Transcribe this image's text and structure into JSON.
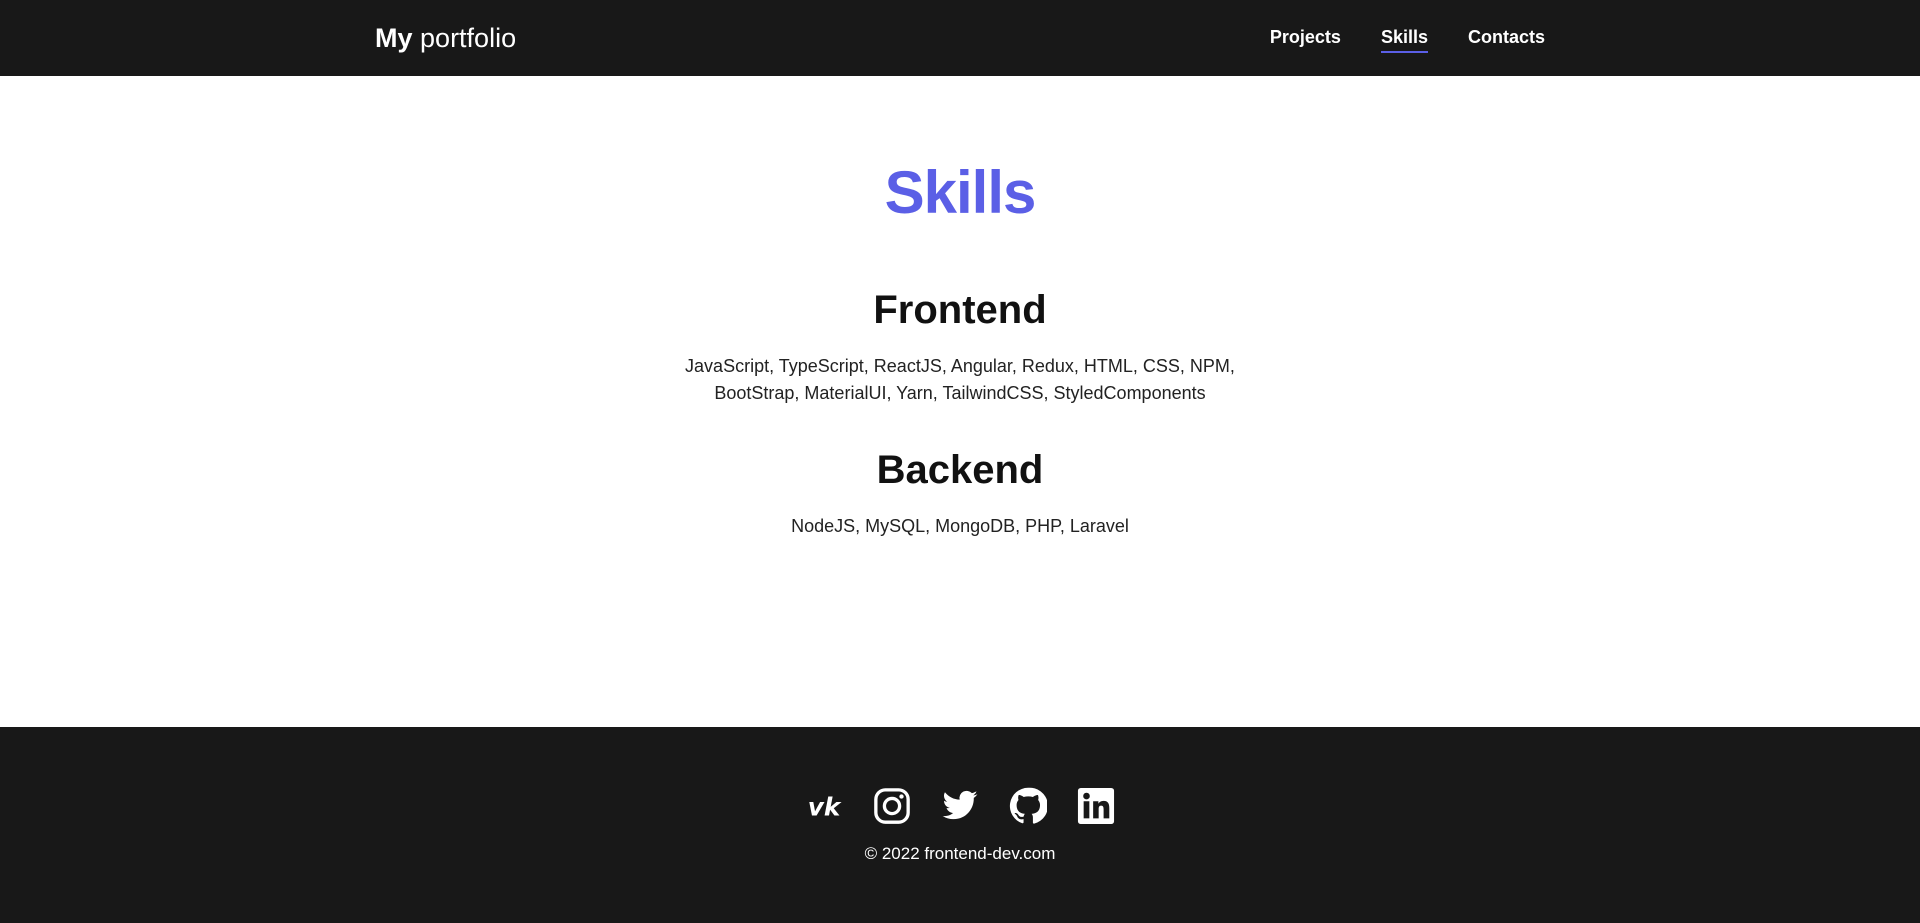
{
  "header": {
    "logo_bold": "My",
    "logo_rest": "portfolio",
    "nav": [
      {
        "label": "Projects",
        "active": false
      },
      {
        "label": "Skills",
        "active": true
      },
      {
        "label": "Contacts",
        "active": false
      }
    ]
  },
  "main": {
    "title": "Skills",
    "sections": [
      {
        "heading": "Frontend",
        "text": "JavaScript, TypeScript, ReactJS, Angular, Redux, HTML, CSS, NPM, BootStrap, MaterialUI, Yarn, TailwindCSS, StyledComponents"
      },
      {
        "heading": "Backend",
        "text": "NodeJS, MySQL, MongoDB, PHP, Laravel"
      }
    ]
  },
  "footer": {
    "socials": [
      "vk-icon",
      "instagram-icon",
      "twitter-icon",
      "github-icon",
      "linkedin-icon"
    ],
    "copyright": "© 2022 frontend-dev.com"
  },
  "colors": {
    "accent": "#5b5fe6",
    "dark": "#181818",
    "text": "#111111"
  }
}
